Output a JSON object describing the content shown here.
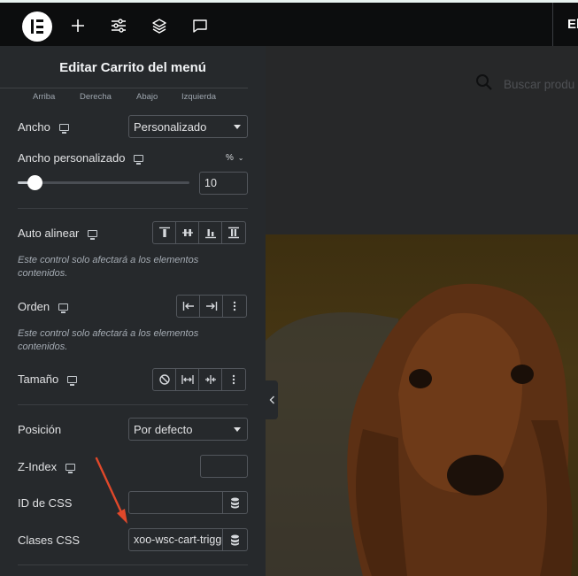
{
  "topbar": {
    "logo_letter": "E",
    "right_label": "El",
    "icons": [
      "plus-icon",
      "sliders-icon",
      "layers-icon",
      "chat-icon"
    ]
  },
  "panel": {
    "title": "Editar Carrito del menú",
    "sides": [
      "Arriba",
      "Derecha",
      "Abajo",
      "Izquierda"
    ],
    "width": {
      "label": "Ancho",
      "value": "Personalizado"
    },
    "custom_width": {
      "label": "Ancho personalizado",
      "unit": "%",
      "value": "10",
      "slider_fraction": 0.1
    },
    "align_self": {
      "label": "Auto alinear",
      "hint": "Este control solo afectará a los elementos contenidos."
    },
    "order": {
      "label": "Orden",
      "hint": "Este control solo afectará a los elementos contenidos."
    },
    "size": {
      "label": "Tamaño"
    },
    "position": {
      "label": "Posición",
      "value": "Por defecto"
    },
    "zindex": {
      "label": "Z-Index",
      "value": ""
    },
    "css_id": {
      "label": "ID de CSS",
      "value": ""
    },
    "css_classes": {
      "label": "Clases CSS",
      "value": "xoo-wsc-cart-trigger"
    }
  },
  "preview": {
    "search_placeholder": "Buscar produ",
    "menu_items": [
      "",
      "",
      "",
      ""
    ]
  },
  "colors": {
    "panel_bg": "#26292c",
    "topbar_bg": "#0c0d0e",
    "annotation_arrow": "#e0482a"
  }
}
